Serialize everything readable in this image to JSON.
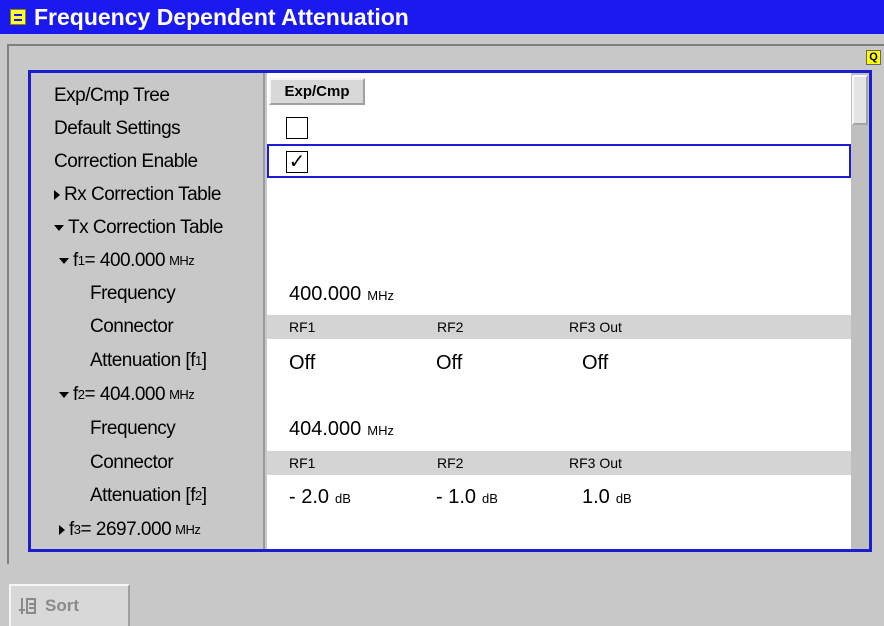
{
  "window": {
    "title": "Frequency Dependent Attenuation"
  },
  "status_icon": "Q",
  "tree": {
    "exp_cmp_tree": {
      "label": "Exp/Cmp Tree",
      "button": "Exp/Cmp"
    },
    "default_settings": {
      "label": "Default Settings",
      "checked": false
    },
    "correction_enable": {
      "label": "Correction Enable",
      "checked": true,
      "check_glyph": "✓"
    },
    "rx_table": {
      "label": "Rx Correction Table",
      "expanded": false
    },
    "tx_table": {
      "label": "Tx Correction Table",
      "expanded": true
    },
    "f1": {
      "prefix": "f",
      "sub": "1",
      "eq": " = 400.000",
      "unit": "MHz",
      "frequency_label": "Frequency",
      "frequency_value": "400.000",
      "frequency_unit": "MHz",
      "connector_label": "Connector",
      "connectors": [
        "RF1",
        "RF2",
        "RF3 Out"
      ],
      "atten_label": "Attenuation [f",
      "atten_sub": "1",
      "atten_close": "]",
      "atten_values": [
        "Off",
        "Off",
        "Off"
      ]
    },
    "f2": {
      "prefix": "f",
      "sub": "2",
      "eq": " = 404.000",
      "unit": "MHz",
      "frequency_label": "Frequency",
      "frequency_value": "404.000",
      "frequency_unit": "MHz",
      "connector_label": "Connector",
      "connectors": [
        "RF1",
        "RF2",
        "RF3 Out"
      ],
      "atten_label": "Attenuation [f",
      "atten_sub": "2",
      "atten_close": "]",
      "atten_values": [
        "- 2.0",
        "- 1.0",
        "1.0"
      ],
      "atten_unit": "dB"
    },
    "f3": {
      "prefix": "f",
      "sub": "3",
      "eq": " = 2697.000",
      "unit": "MHz"
    }
  },
  "sort_button": {
    "label": "Sort"
  },
  "colors": {
    "titlebar": "#1a1af0",
    "focus_border": "#1c1cd0",
    "background": "#c8c8c8"
  }
}
